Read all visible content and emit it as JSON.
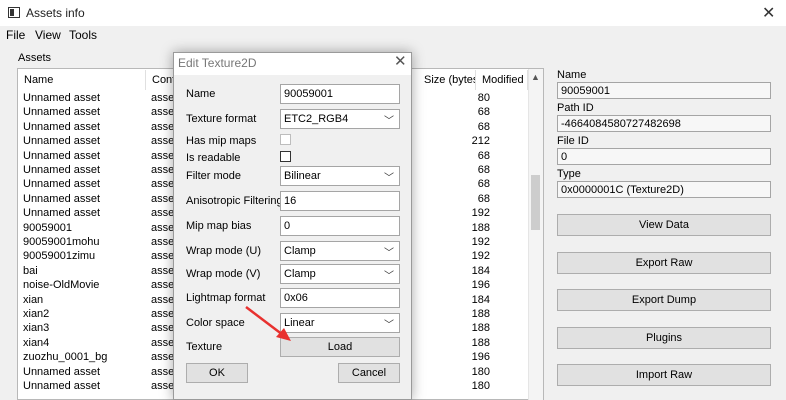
{
  "window": {
    "title": "Assets info",
    "close_glyph": "✕"
  },
  "menu": [
    "File",
    "View",
    "Tools"
  ],
  "assets": {
    "label": "Assets",
    "columns": {
      "name": "Name",
      "container": "Conta",
      "size": "Size (bytes)",
      "modified": "Modified"
    },
    "rows": [
      {
        "name": "Unnamed asset",
        "container": "asset",
        "size": "80"
      },
      {
        "name": "Unnamed asset",
        "container": "asset",
        "size": "68"
      },
      {
        "name": "Unnamed asset",
        "container": "asset",
        "size": "68"
      },
      {
        "name": "Unnamed asset",
        "container": "asset",
        "size": "212"
      },
      {
        "name": "Unnamed asset",
        "container": "asset",
        "size": "68"
      },
      {
        "name": "Unnamed asset",
        "container": "asset",
        "size": "68"
      },
      {
        "name": "Unnamed asset",
        "container": "asset",
        "size": "68"
      },
      {
        "name": "Unnamed asset",
        "container": "asset",
        "size": "68"
      },
      {
        "name": "Unnamed asset",
        "container": "asset",
        "size": "192"
      },
      {
        "name": "90059001",
        "container": "asset",
        "size": "188"
      },
      {
        "name": "90059001mohu",
        "container": "asset",
        "size": "192"
      },
      {
        "name": "90059001zimu",
        "container": "asset",
        "size": "192"
      },
      {
        "name": "bai",
        "container": "asset",
        "size": "184"
      },
      {
        "name": "noise-OldMovie",
        "container": "asset",
        "size": "196"
      },
      {
        "name": "xian",
        "container": "asset",
        "size": "184"
      },
      {
        "name": "xian2",
        "container": "asset",
        "size": "188"
      },
      {
        "name": "xian3",
        "container": "asset",
        "size": "188"
      },
      {
        "name": "xian4",
        "container": "asset",
        "size": "188"
      },
      {
        "name": "zuozhu_0001_bg",
        "container": "asset",
        "size": "196"
      },
      {
        "name": "Unnamed asset",
        "container": "asset",
        "size": "180"
      },
      {
        "name": "Unnamed asset",
        "container": "asset",
        "size": "180"
      }
    ]
  },
  "details": {
    "name_label": "Name",
    "name_value": "90059001",
    "pathid_label": "Path ID",
    "pathid_value": "-4664084580727482698",
    "fileid_label": "File ID",
    "fileid_value": "0",
    "type_label": "Type",
    "type_value": "0x0000001C (Texture2D)"
  },
  "actions": [
    "View Data",
    "Export Raw",
    "Export Dump",
    "Plugins",
    "Import Raw"
  ],
  "dialog": {
    "title": "Edit Texture2D",
    "close_glyph": "✕",
    "fields": {
      "name_label": "Name",
      "name_value": "90059001",
      "format_label": "Texture format",
      "format_value": "ETC2_RGB4",
      "mip_label": "Has mip maps",
      "mip_checked": false,
      "readable_label": "Is readable",
      "readable_checked": false,
      "filter_label": "Filter mode",
      "filter_value": "Bilinear",
      "aniso_label": "Anisotropic Filtering",
      "aniso_value": "16",
      "mipbias_label": "Mip map bias",
      "mipbias_value": "0",
      "wrapu_label": "Wrap mode (U)",
      "wrapu_value": "Clamp",
      "wrapv_label": "Wrap mode (V)",
      "wrapv_value": "Clamp",
      "lightmap_label": "Lightmap format",
      "lightmap_value": "0x06",
      "colorspace_label": "Color space",
      "colorspace_value": "Linear",
      "texture_label": "Texture",
      "load_label": "Load"
    },
    "ok_label": "OK",
    "cancel_label": "Cancel"
  },
  "annotation": {
    "arrow_color": "#e8312f"
  }
}
